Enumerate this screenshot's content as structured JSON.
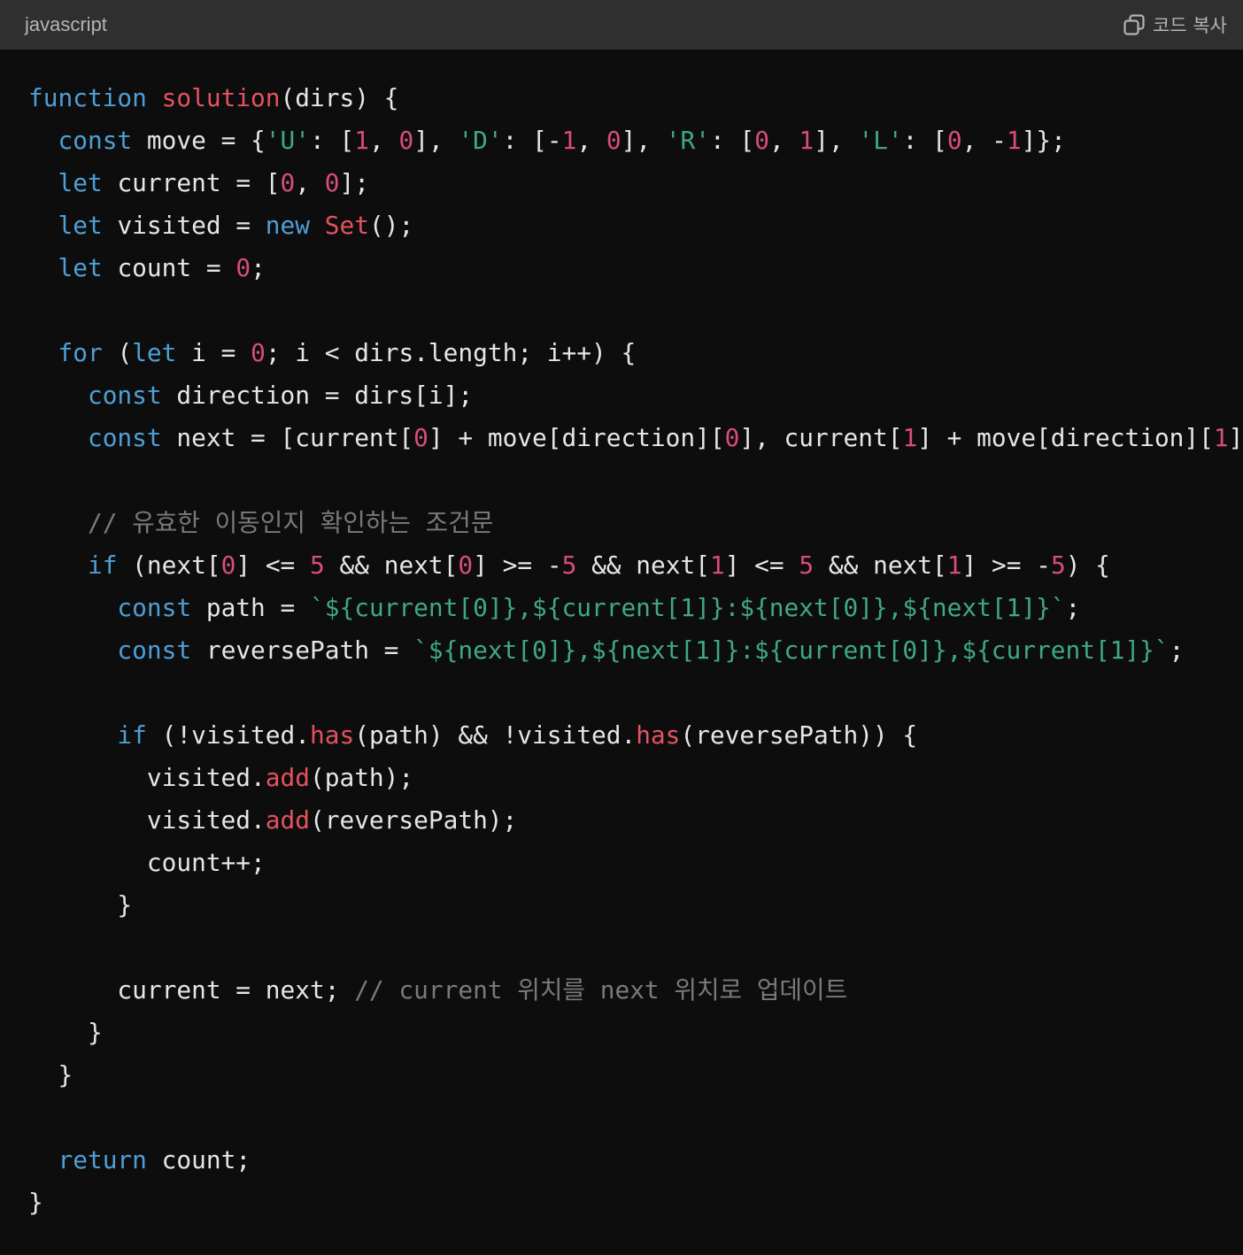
{
  "header": {
    "language": "javascript",
    "copy_label": "코드 복사",
    "copy_icon": "copy-icon"
  },
  "colors": {
    "background": "#0d0d0d",
    "header_background": "#2f2f2f",
    "keyword": "#4e9fd6",
    "function": "#e4525f",
    "number": "#d94c7c",
    "string": "#3fa887",
    "comment": "#7a7a7a",
    "plain": "#e6e6e6"
  },
  "code": {
    "lines": [
      [
        {
          "t": "kw",
          "v": "function"
        },
        {
          "t": "p",
          "v": " "
        },
        {
          "t": "fn",
          "v": "solution"
        },
        {
          "t": "p",
          "v": "(dirs) {"
        }
      ],
      [
        {
          "t": "p",
          "v": "  "
        },
        {
          "t": "kw",
          "v": "const"
        },
        {
          "t": "p",
          "v": " move = {"
        },
        {
          "t": "str",
          "v": "'U'"
        },
        {
          "t": "p",
          "v": ": ["
        },
        {
          "t": "num",
          "v": "1"
        },
        {
          "t": "p",
          "v": ", "
        },
        {
          "t": "num",
          "v": "0"
        },
        {
          "t": "p",
          "v": "], "
        },
        {
          "t": "str",
          "v": "'D'"
        },
        {
          "t": "p",
          "v": ": [-"
        },
        {
          "t": "num",
          "v": "1"
        },
        {
          "t": "p",
          "v": ", "
        },
        {
          "t": "num",
          "v": "0"
        },
        {
          "t": "p",
          "v": "], "
        },
        {
          "t": "str",
          "v": "'R'"
        },
        {
          "t": "p",
          "v": ": ["
        },
        {
          "t": "num",
          "v": "0"
        },
        {
          "t": "p",
          "v": ", "
        },
        {
          "t": "num",
          "v": "1"
        },
        {
          "t": "p",
          "v": "], "
        },
        {
          "t": "str",
          "v": "'L'"
        },
        {
          "t": "p",
          "v": ": ["
        },
        {
          "t": "num",
          "v": "0"
        },
        {
          "t": "p",
          "v": ", -"
        },
        {
          "t": "num",
          "v": "1"
        },
        {
          "t": "p",
          "v": "]};"
        }
      ],
      [
        {
          "t": "p",
          "v": "  "
        },
        {
          "t": "kw",
          "v": "let"
        },
        {
          "t": "p",
          "v": " current = ["
        },
        {
          "t": "num",
          "v": "0"
        },
        {
          "t": "p",
          "v": ", "
        },
        {
          "t": "num",
          "v": "0"
        },
        {
          "t": "p",
          "v": "];"
        }
      ],
      [
        {
          "t": "p",
          "v": "  "
        },
        {
          "t": "kw",
          "v": "let"
        },
        {
          "t": "p",
          "v": " visited = "
        },
        {
          "t": "kw",
          "v": "new"
        },
        {
          "t": "p",
          "v": " "
        },
        {
          "t": "fn",
          "v": "Set"
        },
        {
          "t": "p",
          "v": "();"
        }
      ],
      [
        {
          "t": "p",
          "v": "  "
        },
        {
          "t": "kw",
          "v": "let"
        },
        {
          "t": "p",
          "v": " count = "
        },
        {
          "t": "num",
          "v": "0"
        },
        {
          "t": "p",
          "v": ";"
        }
      ],
      [],
      [
        {
          "t": "p",
          "v": "  "
        },
        {
          "t": "kw",
          "v": "for"
        },
        {
          "t": "p",
          "v": " ("
        },
        {
          "t": "kw",
          "v": "let"
        },
        {
          "t": "p",
          "v": " i = "
        },
        {
          "t": "num",
          "v": "0"
        },
        {
          "t": "p",
          "v": "; i < dirs.length; i++) {"
        }
      ],
      [
        {
          "t": "p",
          "v": "    "
        },
        {
          "t": "kw",
          "v": "const"
        },
        {
          "t": "p",
          "v": " direction = dirs[i];"
        }
      ],
      [
        {
          "t": "p",
          "v": "    "
        },
        {
          "t": "kw",
          "v": "const"
        },
        {
          "t": "p",
          "v": " next = [current["
        },
        {
          "t": "num",
          "v": "0"
        },
        {
          "t": "p",
          "v": "] + move[direction]["
        },
        {
          "t": "num",
          "v": "0"
        },
        {
          "t": "p",
          "v": "], current["
        },
        {
          "t": "num",
          "v": "1"
        },
        {
          "t": "p",
          "v": "] + move[direction]["
        },
        {
          "t": "num",
          "v": "1"
        },
        {
          "t": "p",
          "v": "]"
        }
      ],
      [],
      [
        {
          "t": "p",
          "v": "    "
        },
        {
          "t": "cmt",
          "v": "// 유효한 이동인지 확인하는 조건문"
        }
      ],
      [
        {
          "t": "p",
          "v": "    "
        },
        {
          "t": "kw",
          "v": "if"
        },
        {
          "t": "p",
          "v": " (next["
        },
        {
          "t": "num",
          "v": "0"
        },
        {
          "t": "p",
          "v": "] <= "
        },
        {
          "t": "num",
          "v": "5"
        },
        {
          "t": "p",
          "v": " && next["
        },
        {
          "t": "num",
          "v": "0"
        },
        {
          "t": "p",
          "v": "] >= -"
        },
        {
          "t": "num",
          "v": "5"
        },
        {
          "t": "p",
          "v": " && next["
        },
        {
          "t": "num",
          "v": "1"
        },
        {
          "t": "p",
          "v": "] <= "
        },
        {
          "t": "num",
          "v": "5"
        },
        {
          "t": "p",
          "v": " && next["
        },
        {
          "t": "num",
          "v": "1"
        },
        {
          "t": "p",
          "v": "] >= -"
        },
        {
          "t": "num",
          "v": "5"
        },
        {
          "t": "p",
          "v": ") {"
        }
      ],
      [
        {
          "t": "p",
          "v": "      "
        },
        {
          "t": "kw",
          "v": "const"
        },
        {
          "t": "p",
          "v": " path = "
        },
        {
          "t": "str",
          "v": "`${current[0]},${current[1]}:${next[0]},${next[1]}`"
        },
        {
          "t": "p",
          "v": ";"
        }
      ],
      [
        {
          "t": "p",
          "v": "      "
        },
        {
          "t": "kw",
          "v": "const"
        },
        {
          "t": "p",
          "v": " reversePath = "
        },
        {
          "t": "str",
          "v": "`${next[0]},${next[1]}:${current[0]},${current[1]}`"
        },
        {
          "t": "p",
          "v": ";"
        }
      ],
      [],
      [
        {
          "t": "p",
          "v": "      "
        },
        {
          "t": "kw",
          "v": "if"
        },
        {
          "t": "p",
          "v": " (!visited."
        },
        {
          "t": "fn",
          "v": "has"
        },
        {
          "t": "p",
          "v": "(path) && !visited."
        },
        {
          "t": "fn",
          "v": "has"
        },
        {
          "t": "p",
          "v": "(reversePath)) {"
        }
      ],
      [
        {
          "t": "p",
          "v": "        visited."
        },
        {
          "t": "fn",
          "v": "add"
        },
        {
          "t": "p",
          "v": "(path);"
        }
      ],
      [
        {
          "t": "p",
          "v": "        visited."
        },
        {
          "t": "fn",
          "v": "add"
        },
        {
          "t": "p",
          "v": "(reversePath);"
        }
      ],
      [
        {
          "t": "p",
          "v": "        count++;"
        }
      ],
      [
        {
          "t": "p",
          "v": "      }"
        }
      ],
      [],
      [
        {
          "t": "p",
          "v": "      current = next; "
        },
        {
          "t": "cmt",
          "v": "// current 위치를 next 위치로 업데이트"
        }
      ],
      [
        {
          "t": "p",
          "v": "    }"
        }
      ],
      [
        {
          "t": "p",
          "v": "  }"
        }
      ],
      [],
      [
        {
          "t": "p",
          "v": "  "
        },
        {
          "t": "kw",
          "v": "return"
        },
        {
          "t": "p",
          "v": " count;"
        }
      ],
      [
        {
          "t": "p",
          "v": "}"
        }
      ]
    ]
  }
}
